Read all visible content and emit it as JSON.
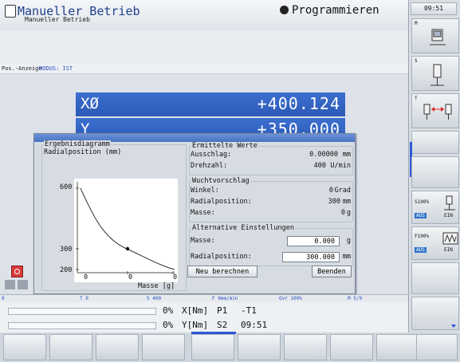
{
  "header": {
    "mode_title": "Manueller Betrieb",
    "mode_subtitle": "Manueller Betrieb",
    "program_label": "Programmieren"
  },
  "position_bar": {
    "label": "Pos.-Anzeige",
    "mode": "MODUS: IST"
  },
  "axes": [
    {
      "name": "XØ",
      "value": "+400.124"
    },
    {
      "name": "Y",
      "value": "+350.000"
    }
  ],
  "dialog": {
    "diagram": {
      "group_title": "Ergebnisdiagramm",
      "y_title": "Radialposition (mm)",
      "y_ticks": [
        "600",
        "300",
        "200"
      ],
      "x_ticks": [
        "0",
        "0",
        "0"
      ],
      "x_title": "Masse [g]"
    },
    "measured": {
      "group_title": "Ermittelte Werte",
      "rows": [
        {
          "label": "Ausschlag:",
          "value": "0.00000",
          "unit": "mm"
        },
        {
          "label": "Drehzahl:",
          "value": "400",
          "unit": "U/min"
        }
      ]
    },
    "suggestion": {
      "group_title": "Wuchtvorschlag",
      "rows": [
        {
          "label": "Winkel:",
          "value": "0",
          "unit": "Grad"
        },
        {
          "label": "Radialposition:",
          "value": "300",
          "unit": "mm"
        },
        {
          "label": "Masse:",
          "value": "0",
          "unit": "g"
        }
      ]
    },
    "alternative": {
      "group_title": "Alternative Einstellungen",
      "mass_label": "Masse:",
      "mass_value": "0.000",
      "mass_unit": "g",
      "radial_label": "Radialposition:",
      "radial_value": "300.000",
      "radial_unit": "mm"
    },
    "buttons": {
      "recalc": "Neu berechnen",
      "exit": "Beenden"
    }
  },
  "status_bar": {
    "items": [
      "0",
      "T 0",
      "S 400",
      "F 0mm/min",
      "Ovr 100%",
      "M 5/9"
    ]
  },
  "info": {
    "line1_pct": "0%",
    "line1_axis": "X[Nm]",
    "line1_p": "P1",
    "line1_t": "-T1",
    "line2_pct": "0%",
    "line2_axis": "Y[Nm]",
    "line2_s": "S2",
    "line2_time": "09:51"
  },
  "sidebar": {
    "time": "09:51",
    "keys": [
      {
        "key": "M"
      },
      {
        "key": "S"
      },
      {
        "key": "T"
      }
    ],
    "s_override": {
      "label": "S100%",
      "aus": "AUS",
      "ein": "EIN"
    },
    "f_override": {
      "label": "F100%",
      "aus": "AUS",
      "ein": "EIN"
    }
  },
  "colors": {
    "axis_row": "#2c59b6",
    "accent": "#2f74c9",
    "dialog_titlebar": "#4772c4"
  }
}
